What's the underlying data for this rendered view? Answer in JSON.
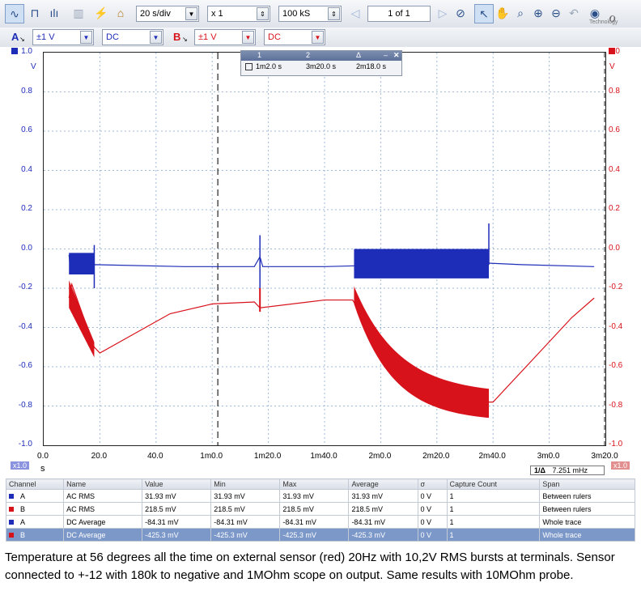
{
  "toolbar": {
    "timebase": "20 s/div",
    "zoom": "x 1",
    "samples": "100 kS",
    "page": "1 of 1",
    "brand": "Technology"
  },
  "channel_a": {
    "letter": "A",
    "range": "±1 V",
    "coupling": "DC",
    "color": "#1e2db8"
  },
  "channel_b": {
    "letter": "B",
    "range": "±1 V",
    "coupling": "DC",
    "color": "#d8121b"
  },
  "rulers": {
    "headers": [
      "1",
      "2",
      "Δ"
    ],
    "values": [
      "1m2.0 s",
      "3m20.0 s",
      "2m18.0 s"
    ]
  },
  "axes": {
    "left_unit": "V",
    "right_unit": "V",
    "left_ticks": [
      "1.0",
      "0.8",
      "0.6",
      "0.4",
      "0.2",
      "0.0",
      "-0.2",
      "-0.4",
      "-0.6",
      "-0.8",
      "-1.0"
    ],
    "right_ticks": [
      "1.0",
      "0.8",
      "0.6",
      "0.4",
      "0.2",
      "0.0",
      "-0.2",
      "-0.4",
      "-0.6",
      "-0.8",
      "-1.0"
    ],
    "x_ticks": [
      "0.0",
      "20.0",
      "40.0",
      "1m0.0",
      "1m20.0",
      "1m40.0",
      "2m0.0",
      "2m20.0",
      "2m40.0",
      "3m0.0",
      "3m20.0"
    ],
    "x_unit": "s",
    "left_scale": "x1.0",
    "right_scale": "x1.0",
    "freq_label": "1/Δ",
    "freq_value": "7.251 mHz"
  },
  "chart_data": {
    "type": "line",
    "xlim": [
      0,
      200
    ],
    "ylim": [
      -1.0,
      1.0
    ],
    "series": [
      {
        "name": "A",
        "color": "#1e2db8",
        "points": [
          [
            9,
            -0.03
          ],
          [
            9.5,
            -0.1
          ],
          [
            18,
            -0.08
          ],
          [
            50,
            -0.09
          ],
          [
            75,
            -0.09
          ],
          [
            77,
            -0.04
          ],
          [
            78,
            -0.09
          ],
          [
            100,
            -0.09
          ],
          [
            155,
            -0.07
          ],
          [
            170,
            -0.08
          ],
          [
            196,
            -0.09
          ]
        ]
      },
      {
        "name": "B",
        "color": "#d8121b",
        "points": [
          [
            9,
            -0.25
          ],
          [
            10,
            -0.18
          ],
          [
            18,
            -0.5
          ],
          [
            20,
            -0.53
          ],
          [
            30,
            -0.45
          ],
          [
            45,
            -0.33
          ],
          [
            60,
            -0.28
          ],
          [
            75,
            -0.27
          ],
          [
            77,
            -0.3
          ],
          [
            100,
            -0.26
          ],
          [
            110,
            -0.26
          ],
          [
            120,
            -0.5
          ],
          [
            140,
            -0.68
          ],
          [
            158,
            -0.78
          ],
          [
            160,
            -0.78
          ],
          [
            175,
            -0.55
          ],
          [
            188,
            -0.35
          ],
          [
            196,
            -0.25
          ]
        ]
      }
    ]
  },
  "table": {
    "headers": [
      "Channel",
      "Name",
      "Value",
      "Min",
      "Max",
      "Average",
      "σ",
      "Capture Count",
      "Span"
    ],
    "rows": [
      [
        "A",
        "AC RMS",
        "31.93 mV",
        "31.93 mV",
        "31.93 mV",
        "31.93 mV",
        "0 V",
        "1",
        "Between rulers"
      ],
      [
        "B",
        "AC RMS",
        "218.5 mV",
        "218.5 mV",
        "218.5 mV",
        "218.5 mV",
        "0 V",
        "1",
        "Between rulers"
      ],
      [
        "A",
        "DC Average",
        "-84.31 mV",
        "-84.31 mV",
        "-84.31 mV",
        "-84.31 mV",
        "0 V",
        "1",
        "Whole trace"
      ],
      [
        "B",
        "DC Average",
        "-425.3 mV",
        "-425.3 mV",
        "-425.3 mV",
        "-425.3 mV",
        "0 V",
        "1",
        "Whole trace"
      ]
    ]
  },
  "caption": "Temperature at 56 degrees all the time on external sensor (red) 20Hz with 10,2V RMS bursts at terminals. Sensor connected to +-12 with 180k to negative and 1MOhm scope on output. Same results with 10MOhm probe."
}
